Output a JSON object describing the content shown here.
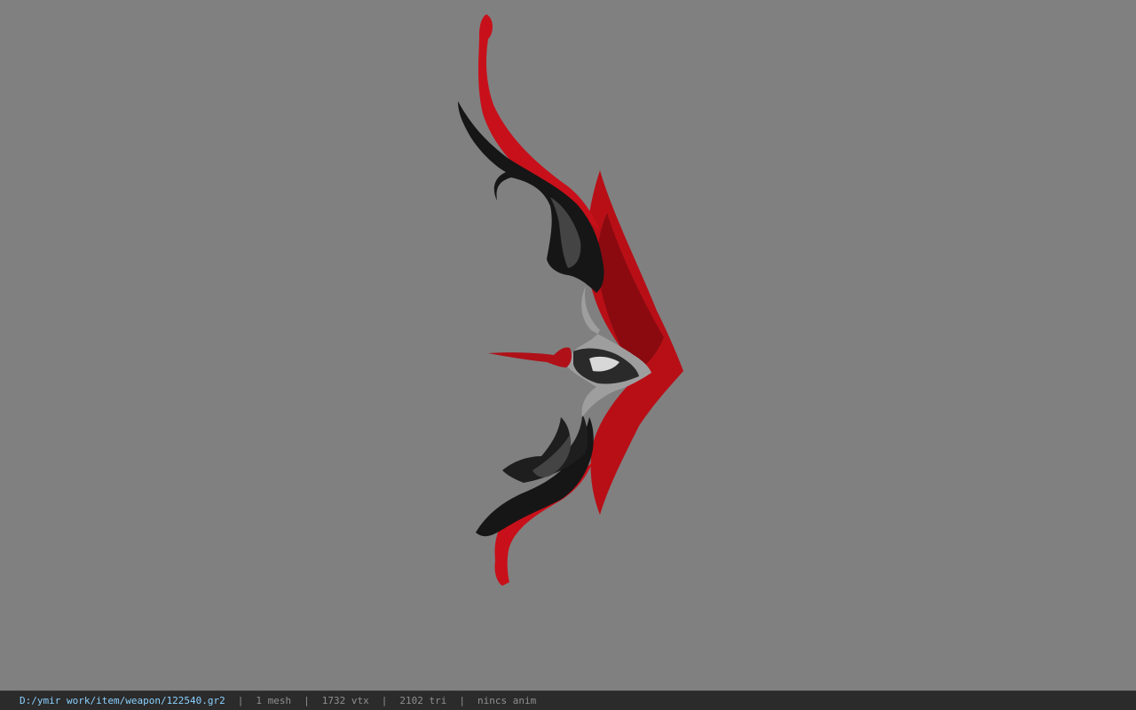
{
  "viewport": {
    "background": "#808080",
    "model": {
      "name": "bow-model",
      "primary_color": "#c8101a",
      "secondary_color": "#1a1a1a",
      "metal_color": "#bdbdbd"
    }
  },
  "status_bar": {
    "path": "D:/ymir work/item/weapon/122540.gr2",
    "separator": "|",
    "mesh": "1 mesh",
    "vtx": "1732 vtx",
    "tri": "2102 tri",
    "anim": "nincs anim",
    "path_color": "#8ad0ff"
  }
}
